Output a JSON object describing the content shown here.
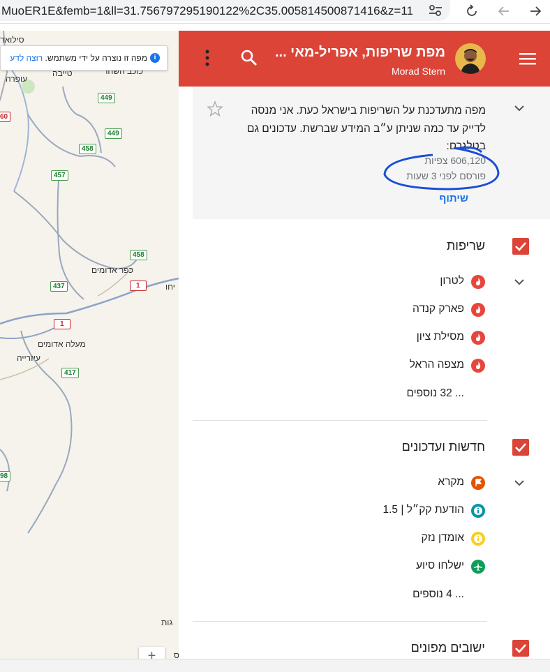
{
  "browser": {
    "url": "MuoER1E&femb=1&ll=31.756797295190122%2C35.005814500871416&z=11"
  },
  "map": {
    "notice": {
      "text": "מפה זו נוצרה על ידי משתמש.",
      "link": "רוצה לדע"
    },
    "labels": [
      {
        "text": "סילואד"
      },
      {
        "text": "כוכב השחר"
      },
      {
        "text": "עופרה"
      },
      {
        "text": "טייבה"
      },
      {
        "text": "כפר אדומים"
      },
      {
        "text": "מעלה אדומים"
      },
      {
        "text": "עיזרייה"
      },
      {
        "text": "יחו"
      },
      {
        "text": "גות"
      },
      {
        "text": "ס"
      }
    ],
    "routes": [
      {
        "num": "449"
      },
      {
        "num": "449"
      },
      {
        "num": "458"
      },
      {
        "num": "457"
      },
      {
        "num": "458"
      },
      {
        "num": "437"
      },
      {
        "num": "1"
      },
      {
        "num": "1"
      },
      {
        "num": "417"
      },
      {
        "num": "60"
      },
      {
        "num": "98"
      }
    ],
    "zoom_in": "+"
  },
  "panel": {
    "header": {
      "title": "מפת שריפות, אפריל-מאי ...",
      "author": "Morad Stern",
      "colors": {
        "accent": "#db4437"
      }
    },
    "description": {
      "text": "מפה מתעדכנת על השריפות בישראל כעת. אני מנסה לדייק עד כמה שניתן ע״ב המידע שברשת. עדכונים גם בטלגרם:",
      "views": "606,120 צפיות",
      "posted": "פורסם לפני 3 שעות",
      "share": "שיתוף"
    },
    "layers": [
      {
        "title": "שריפות",
        "items": [
          {
            "label": "לטרון",
            "icon": "fire-icon",
            "color": "#e8453c"
          },
          {
            "label": "פארק קנדה",
            "icon": "fire-icon",
            "color": "#e8453c"
          },
          {
            "label": "מסילת ציון",
            "icon": "fire-icon",
            "color": "#e8453c"
          },
          {
            "label": "מצפה הראל",
            "icon": "fire-icon",
            "color": "#e8453c"
          }
        ],
        "more": "... 32 נוספים"
      },
      {
        "title": "חדשות ועדכונים",
        "items": [
          {
            "label": "מקרא",
            "icon": "flag-icon",
            "color": "#e65100"
          },
          {
            "label": "הודעת קק״ל | 1.5",
            "icon": "info-icon",
            "color": "#0097a7"
          },
          {
            "label": "אומדן נזק",
            "icon": "info-icon",
            "color": "#f9ce1d"
          },
          {
            "label": "ישלחו סיוע",
            "icon": "plane-icon",
            "color": "#0f9d58"
          }
        ],
        "more": "... 4 נוספים"
      },
      {
        "title": "ישובים מפונים",
        "items": [],
        "more": ""
      }
    ]
  }
}
